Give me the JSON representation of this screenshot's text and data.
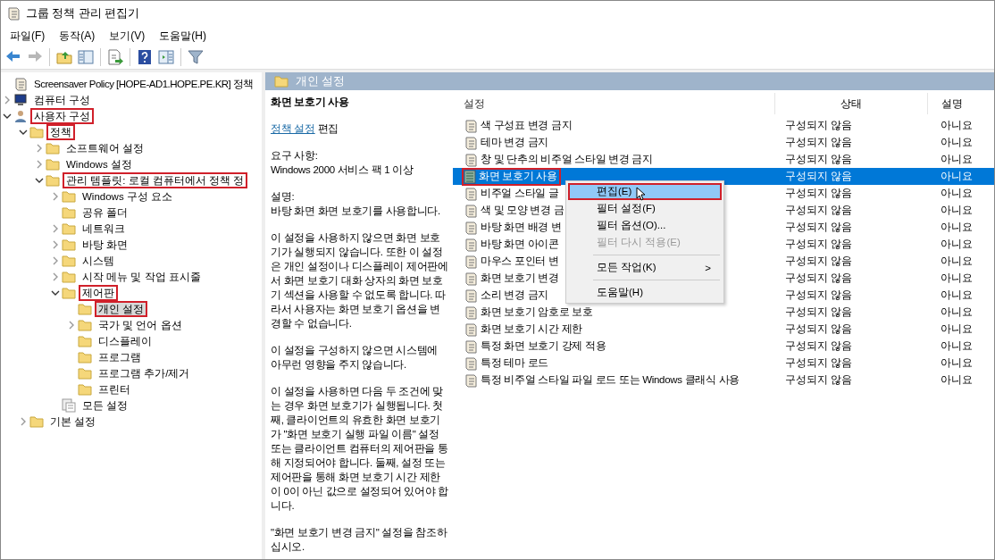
{
  "window": {
    "title": "그룹 정책 관리 편집기"
  },
  "menu": [
    "파일(F)",
    "동작(A)",
    "보기(V)",
    "도움말(H)"
  ],
  "toolbar": [
    {
      "kind": "back",
      "disabled": false
    },
    {
      "kind": "forward",
      "disabled": true
    },
    {
      "kind": "sep"
    },
    {
      "kind": "up",
      "disabled": false
    },
    {
      "kind": "tree",
      "disabled": false
    },
    {
      "kind": "sep"
    },
    {
      "kind": "export",
      "disabled": false
    },
    {
      "kind": "sep"
    },
    {
      "kind": "help",
      "disabled": false
    },
    {
      "kind": "pane",
      "disabled": false
    },
    {
      "kind": "sep"
    },
    {
      "kind": "filter",
      "disabled": false
    }
  ],
  "tree": [
    {
      "label": "Screensaver Policy [HOPE-AD1.HOPE.PE.KR] 정책",
      "kind": "policy",
      "selected": false,
      "marked": false,
      "children": [
        {
          "label": "컴퓨터 구성",
          "kind": "computer",
          "expanded": false,
          "selected": false,
          "marked": false
        },
        {
          "label": "사용자 구성",
          "kind": "user",
          "expanded": true,
          "selected": false,
          "marked": true,
          "children": [
            {
              "label": "정책",
              "kind": "folder",
              "expanded": true,
              "selected": false,
              "marked": true,
              "children": [
                {
                  "label": "소프트웨어 설정",
                  "kind": "folder",
                  "expanded": false,
                  "selected": false,
                  "marked": false
                },
                {
                  "label": "Windows 설정",
                  "kind": "folder",
                  "expanded": false,
                  "selected": false,
                  "marked": false
                },
                {
                  "label": "관리 템플릿: 로컬 컴퓨터에서 정책 정",
                  "kind": "folder",
                  "expanded": true,
                  "selected": false,
                  "marked": true,
                  "children": [
                    {
                      "label": "Windows 구성 요소",
                      "kind": "folder",
                      "expanded": false,
                      "selected": false,
                      "marked": false
                    },
                    {
                      "label": "공유 폴더",
                      "kind": "folder",
                      "selected": false,
                      "marked": false
                    },
                    {
                      "label": "네트워크",
                      "kind": "folder",
                      "expanded": false,
                      "selected": false,
                      "marked": false
                    },
                    {
                      "label": "바탕 화면",
                      "kind": "folder",
                      "expanded": false,
                      "selected": false,
                      "marked": false
                    },
                    {
                      "label": "시스템",
                      "kind": "folder",
                      "expanded": false,
                      "selected": false,
                      "marked": false
                    },
                    {
                      "label": "시작 메뉴 및 작업 표시줄",
                      "kind": "folder",
                      "expanded": false,
                      "selected": false,
                      "marked": false
                    },
                    {
                      "label": "제어판",
                      "kind": "folder",
                      "expanded": true,
                      "selected": false,
                      "marked": true,
                      "children": [
                        {
                          "label": "개인 설정",
                          "kind": "folder",
                          "selected": true,
                          "marked": true
                        },
                        {
                          "label": "국가 및 언어 옵션",
                          "kind": "folder",
                          "expanded": false,
                          "selected": false,
                          "marked": false
                        },
                        {
                          "label": "디스플레이",
                          "kind": "folder",
                          "selected": false,
                          "marked": false
                        },
                        {
                          "label": "프로그램",
                          "kind": "folder",
                          "selected": false,
                          "marked": false
                        },
                        {
                          "label": "프로그램 추가/제거",
                          "kind": "folder",
                          "selected": false,
                          "marked": false
                        },
                        {
                          "label": "프린터",
                          "kind": "folder",
                          "selected": false,
                          "marked": false
                        }
                      ]
                    },
                    {
                      "label": "모든 설정",
                      "kind": "settings",
                      "selected": false,
                      "marked": false
                    }
                  ]
                }
              ]
            },
            {
              "label": "기본 설정",
              "kind": "folder",
              "expanded": false,
              "selected": false,
              "marked": false
            }
          ]
        }
      ]
    }
  ],
  "header": {
    "title": "개인 설정"
  },
  "description": {
    "title": "화면 보호기 사용",
    "link": "정책 설정",
    "link_suffix": "편집",
    "paragraphs": [
      "요구 사항:\nWindows 2000 서비스 팩 1 이상",
      "설명:\n바탕 화면 화면 보호기를 사용합니다.",
      "이 설정을 사용하지 않으면 화면 보호기가 실행되지 않습니다. 또한 이 설정은 개인 설정이나 디스플레이 제어판에서 화면 보호기 대화 상자의 화면 보호기 섹션을 사용할 수 없도록 합니다. 따라서 사용자는 화면 보호기 옵션을 변경할 수 없습니다.",
      "이 설정을 구성하지 않으면 시스템에 아무런 영향을 주지 않습니다.",
      "이 설정을 사용하면 다음 두 조건에 맞는 경우 화면 보호기가 실행됩니다. 첫째, 클라이언트의 유효한 화면 보호기가 \"화면 보호기 실행 파일 이름\" 설정 또는 클라이언트 컴퓨터의 제어판을 통해 지정되어야 합니다. 둘째, 설정 또는 제어판을 통해 화면 보호기 시간 제한이 0이 아닌 값으로 설정되어 있어야 합니다.",
      "\"화면 보호기 변경 금지\" 설정을 참조하십시오."
    ]
  },
  "table": {
    "columns": [
      "설정",
      "상태",
      "설명"
    ],
    "rows": [
      {
        "name": "색 구성표 변경 금지",
        "state": "구성되지 않음",
        "comment": "아니요",
        "kind": "policy",
        "selected": false,
        "marked": false
      },
      {
        "name": "테마 변경 금지",
        "state": "구성되지 않음",
        "comment": "아니요",
        "kind": "policy",
        "selected": false,
        "marked": false
      },
      {
        "name": "창 및 단추의 비주얼 스타일 변경 금지",
        "state": "구성되지 않음",
        "comment": "아니요",
        "kind": "policy",
        "selected": false,
        "marked": false
      },
      {
        "name": "화면 보호기 사용",
        "state": "구성되지 않음",
        "comment": "아니요",
        "kind": "active",
        "selected": true,
        "marked": true
      },
      {
        "name": "비주얼 스타일 글",
        "state": "구성되지 않음",
        "comment": "아니요",
        "kind": "policy",
        "selected": false,
        "marked": false
      },
      {
        "name": "색 및 모양 변경 금",
        "state": "구성되지 않음",
        "comment": "아니요",
        "kind": "policy",
        "selected": false,
        "marked": false
      },
      {
        "name": "바탕 화면 배경 변",
        "state": "구성되지 않음",
        "comment": "아니요",
        "kind": "policy",
        "selected": false,
        "marked": false
      },
      {
        "name": "바탕 화면 아이콘",
        "state": "구성되지 않음",
        "comment": "아니요",
        "kind": "policy",
        "selected": false,
        "marked": false
      },
      {
        "name": "마우스 포인터 변",
        "state": "구성되지 않음",
        "comment": "아니요",
        "kind": "policy",
        "selected": false,
        "marked": false
      },
      {
        "name": "화면 보호기 변경",
        "state": "구성되지 않음",
        "comment": "아니요",
        "kind": "policy",
        "selected": false,
        "marked": false
      },
      {
        "name": "소리 변경 금지",
        "state": "구성되지 않음",
        "comment": "아니요",
        "kind": "policy",
        "selected": false,
        "marked": false
      },
      {
        "name": "화면 보호기 암호로 보호",
        "state": "구성되지 않음",
        "comment": "아니요",
        "kind": "policy",
        "selected": false,
        "marked": false
      },
      {
        "name": "화면 보호기 시간 제한",
        "state": "구성되지 않음",
        "comment": "아니요",
        "kind": "policy",
        "selected": false,
        "marked": false
      },
      {
        "name": "특정 화면 보호기 강제 적용",
        "state": "구성되지 않음",
        "comment": "아니요",
        "kind": "policy",
        "selected": false,
        "marked": false
      },
      {
        "name": "특정 테마 로드",
        "state": "구성되지 않음",
        "comment": "아니요",
        "kind": "policy",
        "selected": false,
        "marked": false
      },
      {
        "name": "특정 비주얼 스타일 파일 로드 또는 Windows 클래식 사용",
        "state": "구성되지 않음",
        "comment": "아니요",
        "kind": "policy",
        "selected": false,
        "marked": false
      }
    ]
  },
  "context_menu": [
    {
      "kind": "item",
      "label": "편집(E)",
      "selected": true,
      "disabled": false,
      "marked": true
    },
    {
      "kind": "item",
      "label": "필터 설정(F)",
      "selected": false,
      "disabled": false,
      "marked": false
    },
    {
      "kind": "item",
      "label": "필터 옵션(O)...",
      "selected": false,
      "disabled": false,
      "marked": false
    },
    {
      "kind": "item",
      "label": "필터 다시 적용(E)",
      "selected": false,
      "disabled": true,
      "marked": false
    },
    {
      "kind": "separator"
    },
    {
      "kind": "submenu",
      "label": "모든 작업(K)",
      "arrow": ">",
      "selected": false,
      "disabled": false,
      "marked": false
    },
    {
      "kind": "separator"
    },
    {
      "kind": "item",
      "label": "도움말(H)",
      "selected": false,
      "disabled": false,
      "marked": false
    }
  ]
}
